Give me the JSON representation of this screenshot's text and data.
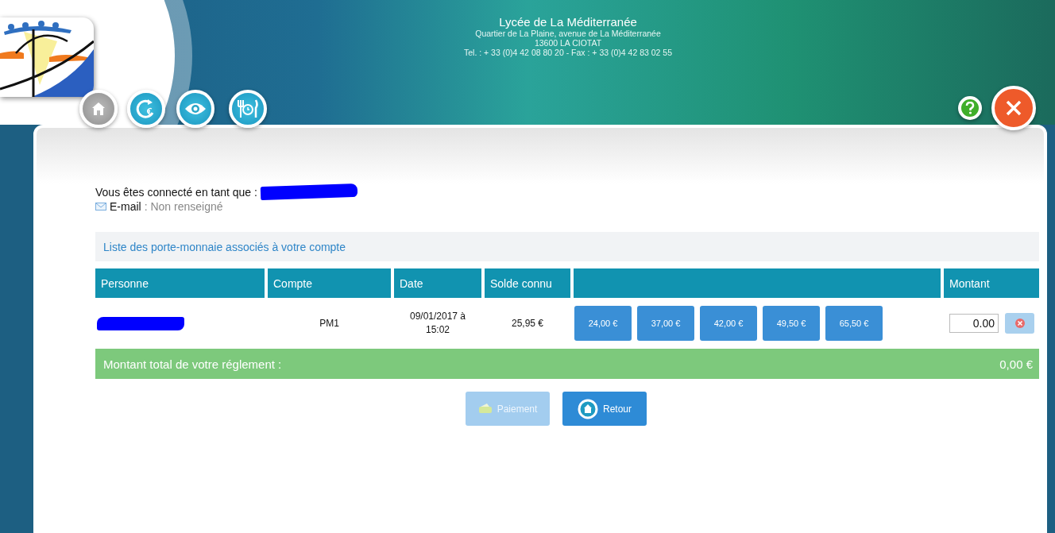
{
  "header": {
    "school_name": "Lycée de La Méditerranée",
    "address": "Quartier de La Plaine, avenue de La Méditerranée",
    "city": "13600 LA CIOTAT",
    "contact": "Tel. : + 33 (0)4 42 08 80 20 - Fax : + 33 (0)4 42 83 02 55"
  },
  "nav_buttons": [
    {
      "kind": "home",
      "disabled": true
    },
    {
      "kind": "refill",
      "disabled": false
    },
    {
      "kind": "view",
      "disabled": false
    },
    {
      "kind": "meals",
      "disabled": false
    }
  ],
  "corner_buttons": [
    {
      "kind": "help"
    },
    {
      "kind": "close"
    }
  ],
  "user": {
    "label": "Vous êtes connecté en tant que :",
    "name_redacted": true,
    "email_label": "E-mail",
    "email_value": ": Non renseigné"
  },
  "wallets": {
    "title": "Liste des porte-monnaie associés à votre compte",
    "columns": [
      "Personne",
      "Compte",
      "Date",
      "Solde connu",
      null,
      "Montant"
    ],
    "rows": [
      {
        "person_redacted": true,
        "account": "PM1",
        "date": "09/01/2017 à 15:02",
        "balance": "25,95 €",
        "amounts": [
          "24,00 €",
          "37,00 €",
          "42,00 €",
          "49,50 €",
          "65,50 €"
        ],
        "amount_value": "0.00"
      }
    ]
  },
  "total": {
    "label": "Montant total de votre réglement :",
    "value": "0,00 €"
  },
  "actions": [
    {
      "kind": "payment",
      "label": "Paiement",
      "disabled": true
    },
    {
      "kind": "back",
      "label": "Retour",
      "disabled": false
    }
  ]
}
